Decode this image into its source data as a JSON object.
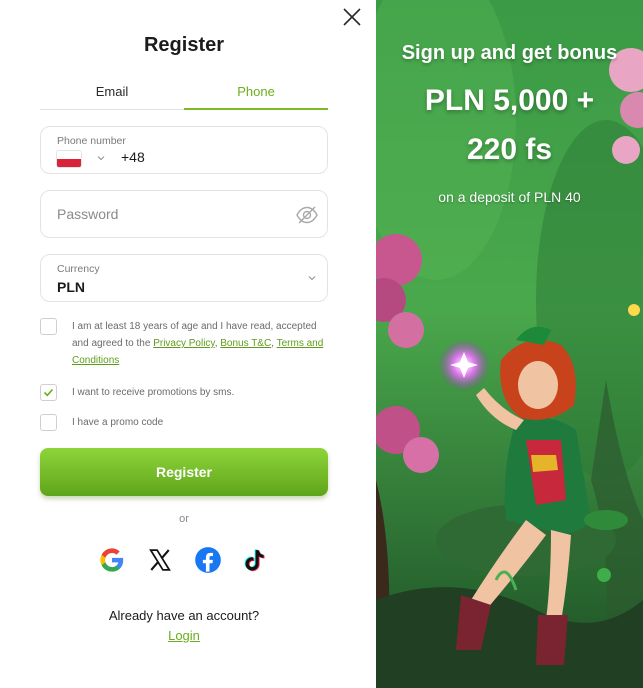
{
  "modal": {
    "title": "Register",
    "tabs": [
      {
        "label": "Email",
        "active": false
      },
      {
        "label": "Phone",
        "active": true
      }
    ],
    "phone": {
      "label": "Phone number",
      "country_flag": "poland-flag",
      "code": "+48"
    },
    "password": {
      "placeholder": "Password"
    },
    "currency": {
      "label": "Currency",
      "value": "PLN"
    },
    "terms": {
      "text": "I am at least 18 years of age and I have read, accepted and agreed to the",
      "privacy_link": "Privacy Policy",
      "separator": ",",
      "bonus_link": "Bonus T&C",
      "separator2": ",",
      "terms_link": "Terms and Conditions",
      "checked": false
    },
    "sms_promotions": {
      "text": "I want to receive promotions by sms.",
      "checked": true
    },
    "promo_code": {
      "text": "I have a promo code",
      "checked": false
    },
    "register_button": "Register",
    "or_label": "or",
    "social_icons": [
      "google-icon",
      "x-icon",
      "facebook-icon",
      "tiktok-icon"
    ],
    "account_question": "Already have an account?",
    "login_link": "Login"
  },
  "promo": {
    "title": "Sign up and get bonus",
    "amount": "PLN 5,000 +",
    "free_spins": "220 fs",
    "subtitle": "on a deposit of PLN 40"
  },
  "colors": {
    "accent": "#7cbb24",
    "accent_dark": "#5fa51a",
    "link": "#6aae1d",
    "promo_bg": "#3f9f45"
  }
}
